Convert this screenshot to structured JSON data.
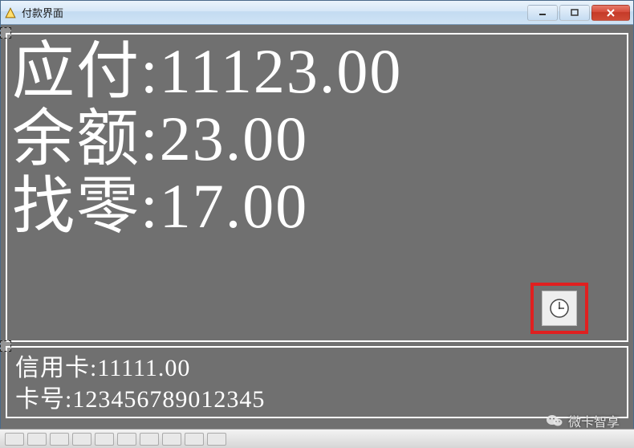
{
  "window": {
    "title": "付款界面"
  },
  "amounts": {
    "due_label": "应付",
    "due_value": "11123.00",
    "balance_label": "余额",
    "balance_value": "23.00",
    "change_label": "找零",
    "change_value": "17.00"
  },
  "card": {
    "credit_label": "信用卡",
    "credit_value": "11111.00",
    "cardno_label": "卡号",
    "cardno_value": "123456789012345"
  },
  "watermark": {
    "text": "微卡智享"
  }
}
